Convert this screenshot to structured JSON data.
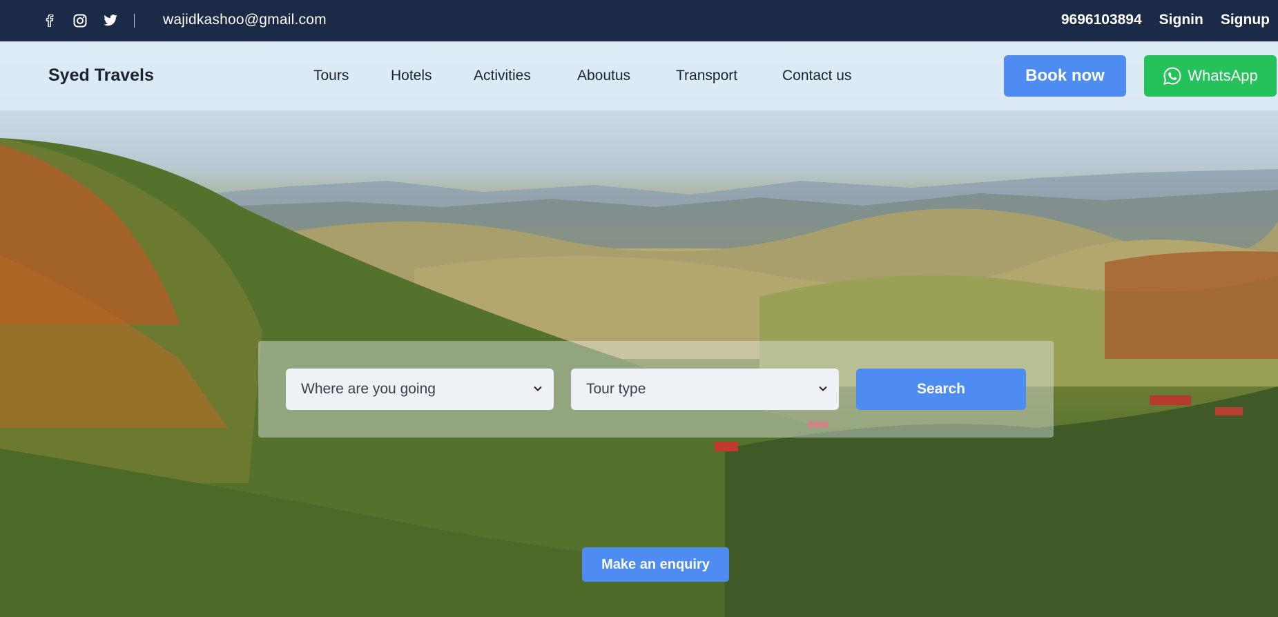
{
  "topbar": {
    "icons": [
      "facebook-icon",
      "instagram-icon",
      "twitter-icon"
    ],
    "email": "wajidkashoo@gmail.com",
    "phone": "9696103894",
    "signin_label": "Signin",
    "signup_label": "Signup"
  },
  "nav": {
    "brand": "Syed Travels",
    "links": [
      "Tours",
      "Hotels",
      "Activities",
      "Aboutus",
      "Transport",
      "Contact us"
    ],
    "book_label": "Book now",
    "whatsapp_label": "WhatsApp"
  },
  "search": {
    "destination_value": "Where are you going",
    "tour_type_value": "Tour type",
    "search_label": "Search"
  },
  "enquiry_label": "Make an enquiry",
  "colors": {
    "topbar_bg": "#1b2a47",
    "primary_button": "#4e8cf2",
    "whatsapp_green": "#25c15a"
  }
}
